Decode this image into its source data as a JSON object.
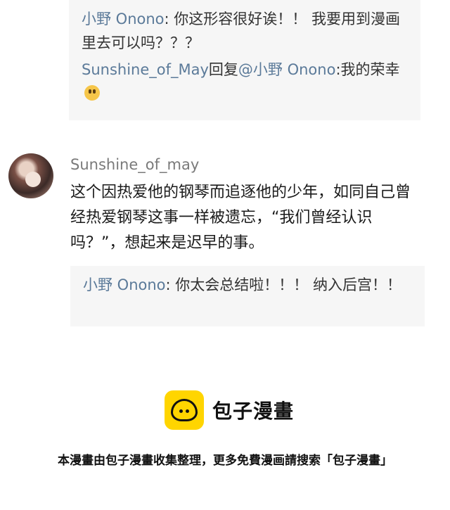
{
  "reply_thread_1": {
    "reply_1": {
      "author": "小野 Onono",
      "text": ": 你这形容很好诶！！ 我要用到漫画里去可以吗？？？"
    },
    "reply_2": {
      "author": "Sunshine_of_May",
      "reply_word": "回复",
      "mention": "@小野 Onono",
      "text": ":我的荣幸",
      "emoji": "face-with-open-mouth-emoji"
    }
  },
  "comment": {
    "author": "Sunshine_of_may",
    "body": "这个因热爱他的钢琴而追逐他的少年，如同自己曾经热爱钢琴这事一样被遗忘，“我们曾经认识吗？”，想起来是迟早的事。"
  },
  "reply_thread_2": {
    "reply_1": {
      "author": "小野 Onono",
      "text": ": 你太会总结啦！！！ 纳入后宫！！"
    }
  },
  "brand": {
    "name": "包子漫畫",
    "logo_color": "#ffd500"
  },
  "footer": {
    "text": "本漫畫由包子漫畫收集整理，更多免費漫画請搜索「包子漫畫」"
  },
  "colors": {
    "username": "#5b7a99",
    "reply_bg": "#f6f6f6"
  }
}
